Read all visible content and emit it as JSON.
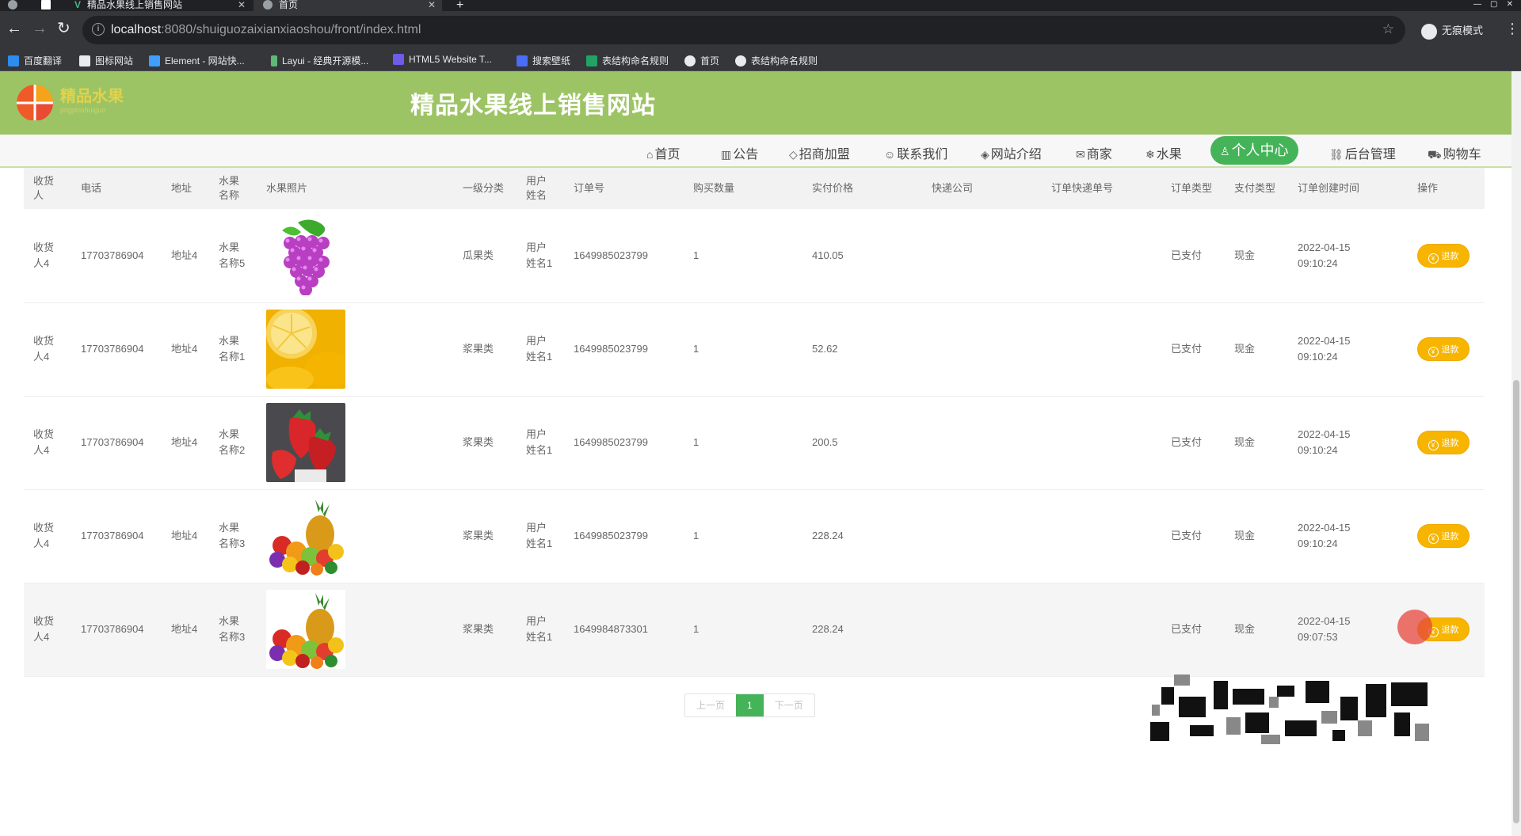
{
  "browser": {
    "tabs": [
      {
        "title": "精品水果线上销售网站"
      },
      {
        "title": "首页"
      }
    ],
    "url_host": "localhost",
    "url_path": ":8080/shuiguozaixianxiaoshou/front/index.html",
    "profile_label": "无痕模式",
    "bookmarks": [
      "百度翻译",
      "图标网站",
      "Element - 网站快...",
      "Layui - 经典开源模...",
      "HTML5 Website T...",
      "搜索壁纸",
      "表结构命名规则",
      "首页",
      "表结构命名规则"
    ]
  },
  "site": {
    "title": "精品水果线上销售网站",
    "logo_text": "精品水果"
  },
  "nav": {
    "items": [
      {
        "label": "首页",
        "icon": "home-icon"
      },
      {
        "label": "公告",
        "icon": "notice-icon"
      },
      {
        "label": "招商加盟",
        "icon": "tag-icon"
      },
      {
        "label": "联系我们",
        "icon": "contact-icon"
      },
      {
        "label": "网站介绍",
        "icon": "layers-icon"
      },
      {
        "label": "商家",
        "icon": "mail-icon"
      },
      {
        "label": "水果",
        "icon": "snowflake-icon"
      },
      {
        "label": "个人中心",
        "icon": "user-icon"
      },
      {
        "label": "后台管理",
        "icon": "link-icon"
      },
      {
        "label": "购物车",
        "icon": "cart-icon"
      }
    ],
    "active": "个人中心"
  },
  "table": {
    "headers": [
      "收货人",
      "电话",
      "地址",
      "水果名称",
      "水果照片",
      "一级分类",
      "用户姓名",
      "订单号",
      "购买数量",
      "实付价格",
      "快递公司",
      "订单快递单号",
      "订单类型",
      "支付类型",
      "订单创建时间",
      "操作"
    ],
    "rows": [
      {
        "receiver": "收货人4",
        "phone": "17703786904",
        "address": "地址4",
        "fruit_name": "水果名称5",
        "photo": "grapes",
        "category": "瓜果类",
        "username": "用户姓名1",
        "order_no": "1649985023799",
        "qty": "1",
        "price": "410.05",
        "express": "",
        "express_no": "",
        "order_type": "已支付",
        "pay_type": "现金",
        "date": "2022-04-15",
        "time": "09:10:24",
        "action": "退款"
      },
      {
        "receiver": "收货人4",
        "phone": "17703786904",
        "address": "地址4",
        "fruit_name": "水果名称1",
        "photo": "lemons",
        "category": "浆果类",
        "username": "用户姓名1",
        "order_no": "1649985023799",
        "qty": "1",
        "price": "52.62",
        "express": "",
        "express_no": "",
        "order_type": "已支付",
        "pay_type": "现金",
        "date": "2022-04-15",
        "time": "09:10:24",
        "action": "退款"
      },
      {
        "receiver": "收货人4",
        "phone": "17703786904",
        "address": "地址4",
        "fruit_name": "水果名称2",
        "photo": "strawberries",
        "category": "浆果类",
        "username": "用户姓名1",
        "order_no": "1649985023799",
        "qty": "1",
        "price": "200.5",
        "express": "",
        "express_no": "",
        "order_type": "已支付",
        "pay_type": "现金",
        "date": "2022-04-15",
        "time": "09:10:24",
        "action": "退款"
      },
      {
        "receiver": "收货人4",
        "phone": "17703786904",
        "address": "地址4",
        "fruit_name": "水果名称3",
        "photo": "mixed-fruits",
        "category": "浆果类",
        "username": "用户姓名1",
        "order_no": "1649985023799",
        "qty": "1",
        "price": "228.24",
        "express": "",
        "express_no": "",
        "order_type": "已支付",
        "pay_type": "现金",
        "date": "2022-04-15",
        "time": "09:10:24",
        "action": "退款"
      },
      {
        "receiver": "收货人4",
        "phone": "17703786904",
        "address": "地址4",
        "fruit_name": "水果名称3",
        "photo": "mixed-fruits",
        "category": "浆果类",
        "username": "用户姓名1",
        "order_no": "1649984873301",
        "qty": "1",
        "price": "228.24",
        "express": "",
        "express_no": "",
        "order_type": "已支付",
        "pay_type": "现金",
        "date": "2022-04-15",
        "time": "09:07:53",
        "action": "退款"
      }
    ]
  },
  "pager": {
    "prev": "上一页",
    "current": "1",
    "next": "下一页"
  },
  "colors": {
    "header_bg": "#9dc464",
    "active_nav": "#45b358",
    "refund_btn": "#f7b500"
  }
}
